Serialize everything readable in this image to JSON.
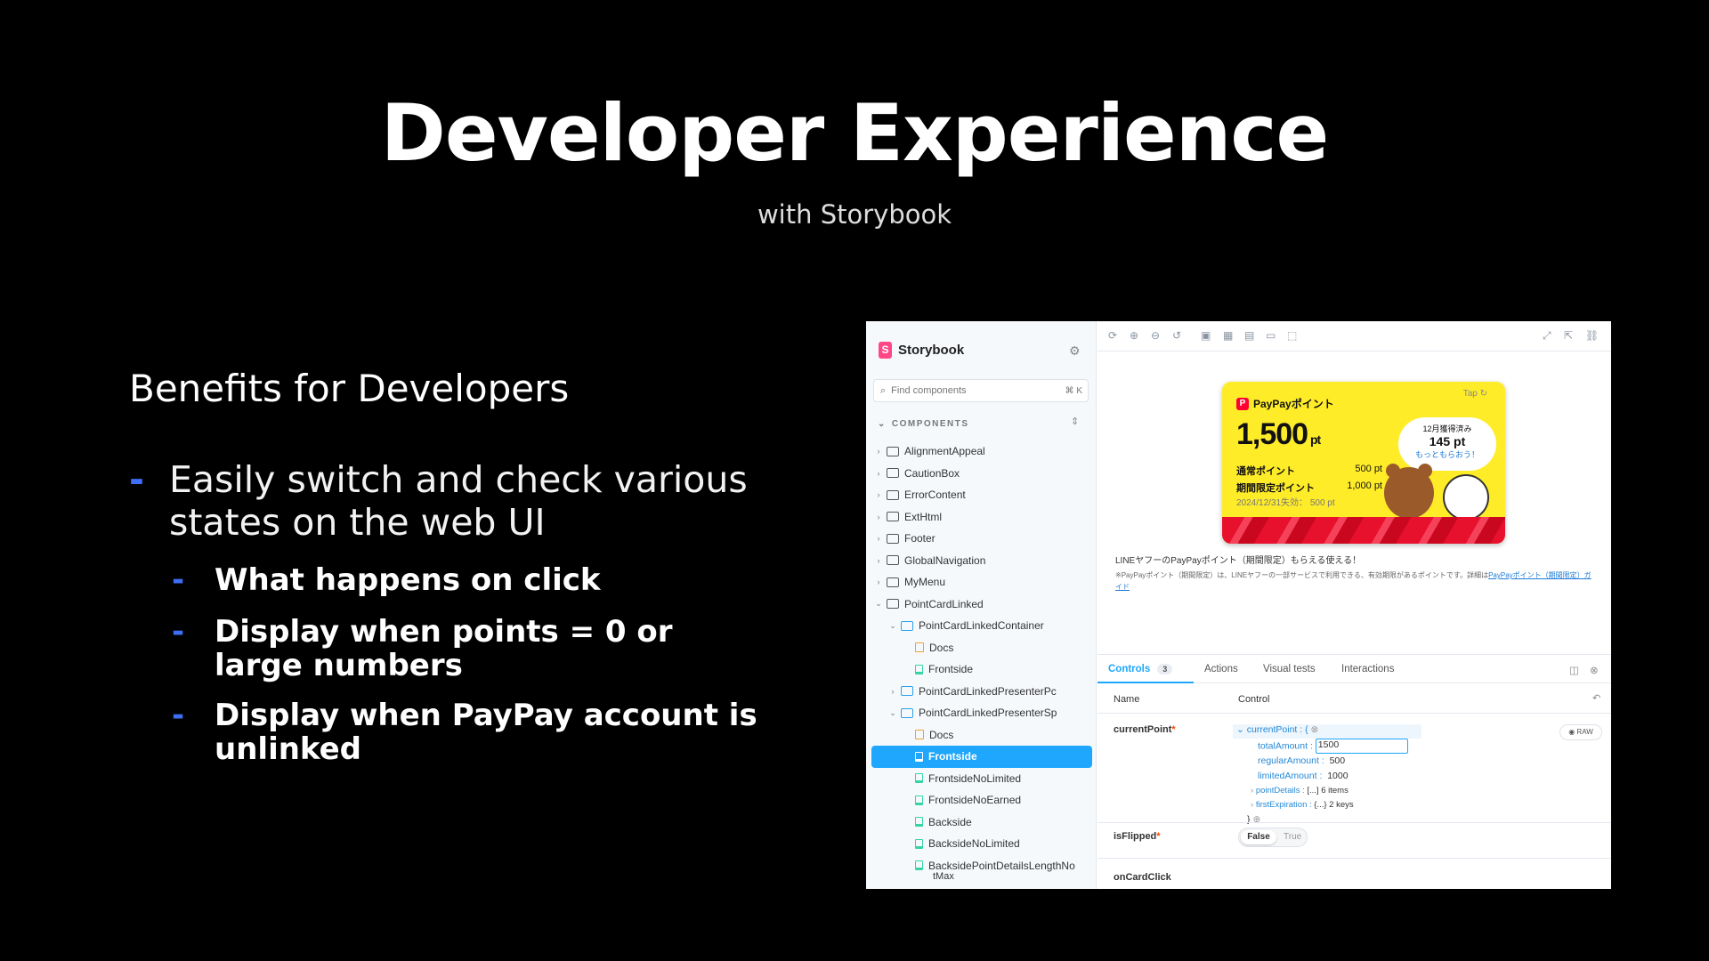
{
  "slide": {
    "title": "Developer Experience",
    "subtitle": "with Storybook",
    "section_heading": "Benefits for Developers",
    "bullets": {
      "main": "Easily switch and check various states on the web UI",
      "sub": [
        "What happens on click",
        "Display when points = 0 or large numbers",
        "Display when PayPay account is unlinked"
      ],
      "dash": "-"
    }
  },
  "storybook": {
    "brand": "Storybook",
    "search_placeholder": "Find components",
    "search_shortcut": "⌘ K",
    "section": "COMPONENTS",
    "tree": [
      {
        "label": "AlignmentAppeal",
        "type": "folder",
        "level": 0,
        "chev": "›"
      },
      {
        "label": "CautionBox",
        "type": "folder",
        "level": 0,
        "chev": "›"
      },
      {
        "label": "ErrorContent",
        "type": "folder",
        "level": 0,
        "chev": "›"
      },
      {
        "label": "ExtHtml",
        "type": "folder",
        "level": 0,
        "chev": "›"
      },
      {
        "label": "Footer",
        "type": "folder",
        "level": 0,
        "chev": "›"
      },
      {
        "label": "GlobalNavigation",
        "type": "folder",
        "level": 0,
        "chev": "›"
      },
      {
        "label": "MyMenu",
        "type": "folder",
        "level": 0,
        "chev": "›"
      },
      {
        "label": "PointCardLinked",
        "type": "folder",
        "level": 0,
        "chev": "⌄"
      },
      {
        "label": "PointCardLinkedContainer",
        "type": "comp",
        "level": 1,
        "chev": "⌄"
      },
      {
        "label": "Docs",
        "type": "doc",
        "level": 2,
        "chev": ""
      },
      {
        "label": "Frontside",
        "type": "story",
        "level": 2,
        "chev": ""
      },
      {
        "label": "PointCardLinkedPresenterPc",
        "type": "comp",
        "level": 1,
        "chev": "›"
      },
      {
        "label": "PointCardLinkedPresenterSp",
        "type": "comp",
        "level": 1,
        "chev": "⌄"
      },
      {
        "label": "Docs",
        "type": "doc",
        "level": 2,
        "chev": ""
      },
      {
        "label": "Frontside",
        "type": "story",
        "level": 2,
        "chev": "",
        "selected": true
      },
      {
        "label": "FrontsideNoLimited",
        "type": "story",
        "level": 2,
        "chev": ""
      },
      {
        "label": "FrontsideNoEarned",
        "type": "story",
        "level": 2,
        "chev": ""
      },
      {
        "label": "Backside",
        "type": "story",
        "level": 2,
        "chev": ""
      },
      {
        "label": "BacksideNoLimited",
        "type": "story",
        "level": 2,
        "chev": ""
      },
      {
        "label": "BacksidePointDetailsLengthNo",
        "type": "story",
        "level": 2,
        "chev": ""
      },
      {
        "label": "tMax",
        "type": "none",
        "level": 2,
        "chev": ""
      }
    ],
    "card": {
      "brand": "PayPayポイント",
      "tap": "Tap",
      "amount": "1,500",
      "unit": "pt",
      "regular_label": "通常ポイント",
      "regular_value": "500 pt",
      "limited_label": "期間限定ポイント",
      "limited_value": "1,000 pt",
      "expiration": "2024/12/31失効： 500 pt",
      "bubble_title": "12月獲得済み",
      "bubble_points": "145 pt",
      "bubble_more": "もっともらおう！"
    },
    "description": {
      "headline": "LINEヤフーのPayPayポイント（期間限定）もらえる使える！",
      "body": "※PayPayポイント（期間限定）は、LINEヤフーの一部サービスで利用できる、有効期限があるポイントです。詳細は",
      "link": "PayPayポイント（期間限定）ガイド"
    },
    "addon_tabs": {
      "controls": "Controls",
      "controls_count": "3",
      "actions": "Actions",
      "visual": "Visual tests",
      "interactions": "Interactions"
    },
    "controls": {
      "name_header": "Name",
      "control_header": "Control",
      "raw": "RAW",
      "currentPoint": {
        "name": "currentPoint",
        "obj_key": "currentPoint : {",
        "total_key": "totalAmount :",
        "total_value": "1500",
        "regular_key": "regularAmount :",
        "regular_value": "500",
        "limited_key": "limitedAmount :",
        "limited_value": "1000",
        "details_key": "pointDetails :",
        "details_value": "[...] 6 items",
        "first_key": "firstExpiration :",
        "first_value": "{...} 2 keys",
        "close": "}"
      },
      "isFlipped": {
        "name": "isFlipped",
        "false": "False",
        "true": "True"
      },
      "asterisk": "*",
      "next_row": "onCardClick"
    }
  }
}
